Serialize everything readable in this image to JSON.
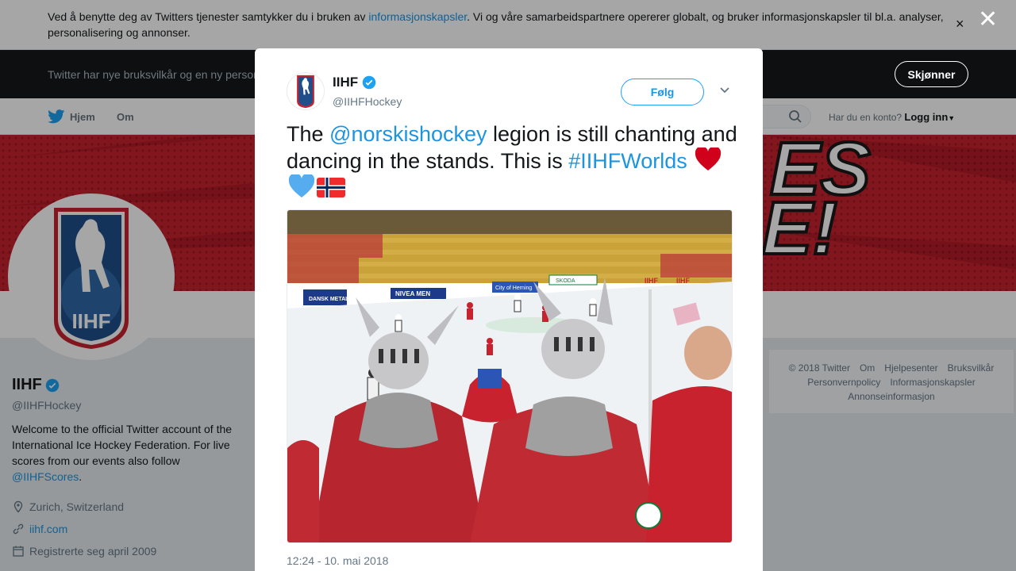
{
  "cookie_bar": {
    "text_before": "Ved å benytte deg av Twitters tjenester samtykker du i bruken av ",
    "link": "informasjonskapsler",
    "text_after": ". Vi og våre samarbeidspartnere opererer globalt, og bruker informasjonskapsler til bl.a. analyser, personalisering og annonser.",
    "close": "×"
  },
  "terms_bar": {
    "text": "Twitter har nye bruksvilkår og en ny personvernpolicy",
    "button": "Skjønner"
  },
  "nav": {
    "home": "Hjem",
    "about": "Om",
    "account_prompt": "Har du en konto?",
    "login": "Logg inn"
  },
  "profile": {
    "name": "IIHF",
    "handle": "@IIHFHockey",
    "bio": "Welcome to the official Twitter account of the International Ice Hockey Federation. For live scores from our events also follow ",
    "bio_link": "@IIHFScores",
    "bio_end": ".",
    "location": "Zurich, Switzerland",
    "website": "iihf.com",
    "joined": "Registrerte seg april 2009",
    "logo_text": "IIHF"
  },
  "footer": {
    "links_row1": [
      "© 2018 Twitter",
      "Om",
      "Hjelpesenter",
      "Bruksvilkår"
    ],
    "links_row2": [
      "Personvernpolicy",
      "Informasjonskapsler"
    ],
    "links_row3": [
      "Annonseinformasjon"
    ]
  },
  "modal": {
    "close": "✕",
    "name": "IIHF",
    "handle": "@IIHFHockey",
    "follow": "Følg",
    "text_1": "The ",
    "mention": "@norskishockey",
    "text_2": " legion is still chanting and dancing in the stands. This is ",
    "hashtag": "#IIHFWorlds",
    "timestamp": "12:24 - 10. mai 2018",
    "photo_ad_banners": [
      "DANSK METAL",
      "NIVEA MEN",
      "SKODA",
      "IIHF",
      "City of Herning"
    ]
  },
  "colors": {
    "twitter_blue": "#1da1f2",
    "link_blue": "#1b95e0",
    "banner_red": "#c8222e",
    "dark": "#14171a"
  }
}
